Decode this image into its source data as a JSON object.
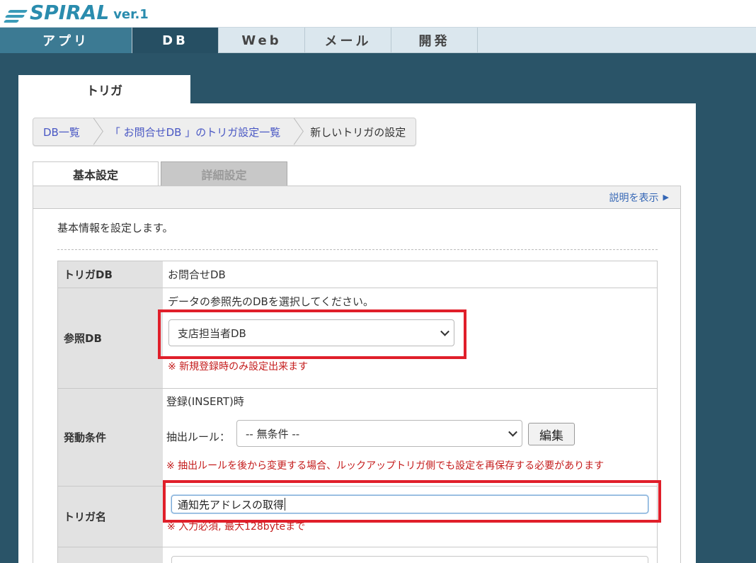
{
  "logo": {
    "text": "SPIRAL",
    "version": "ver.1"
  },
  "nav": {
    "items": [
      {
        "label": "アプリ"
      },
      {
        "label": "DB"
      },
      {
        "label": "Web"
      },
      {
        "label": "メール"
      },
      {
        "label": "開発"
      }
    ],
    "active": "DB"
  },
  "page_tab": {
    "label": "トリガ"
  },
  "breadcrumb": {
    "items": [
      {
        "label": "DB一覧"
      },
      {
        "label": "「 お問合せDB 」のトリガ設定一覧"
      },
      {
        "label": "新しいトリガの設定"
      }
    ]
  },
  "settings_tabs": {
    "basic": "基本設定",
    "detail": "詳細設定"
  },
  "help_link": "説明を表示",
  "intro_text": "基本情報を設定します。",
  "form": {
    "trigger_db": {
      "label": "トリガDB",
      "value": "お問合せDB"
    },
    "ref_db": {
      "label": "参照DB",
      "hint": "データの参照先のDBを選択してください。",
      "selected": "支店担当者DB",
      "note": "※ 新規登録時のみ設定出来ます"
    },
    "condition": {
      "label": "発動条件",
      "event": "登録(INSERT)時",
      "rule_label": "抽出ルール：",
      "rule_selected": "-- 無条件 --",
      "edit_button": "編集",
      "note": "※ 抽出ルールを後から変更する場合、ルックアップトリガ側でも設定を再保存する必要があります"
    },
    "trigger_name": {
      "label": "トリガ名",
      "value": "通知先アドレスの取得",
      "note": "※ 入力必須, 最大128byteまで"
    }
  },
  "colors": {
    "nav_active": "#264f63",
    "nav_app": "#3c7a93",
    "stage": "#2a5468",
    "highlight": "#e01f2a",
    "note_red": "#c41c1c",
    "link": "#4a58c4"
  }
}
